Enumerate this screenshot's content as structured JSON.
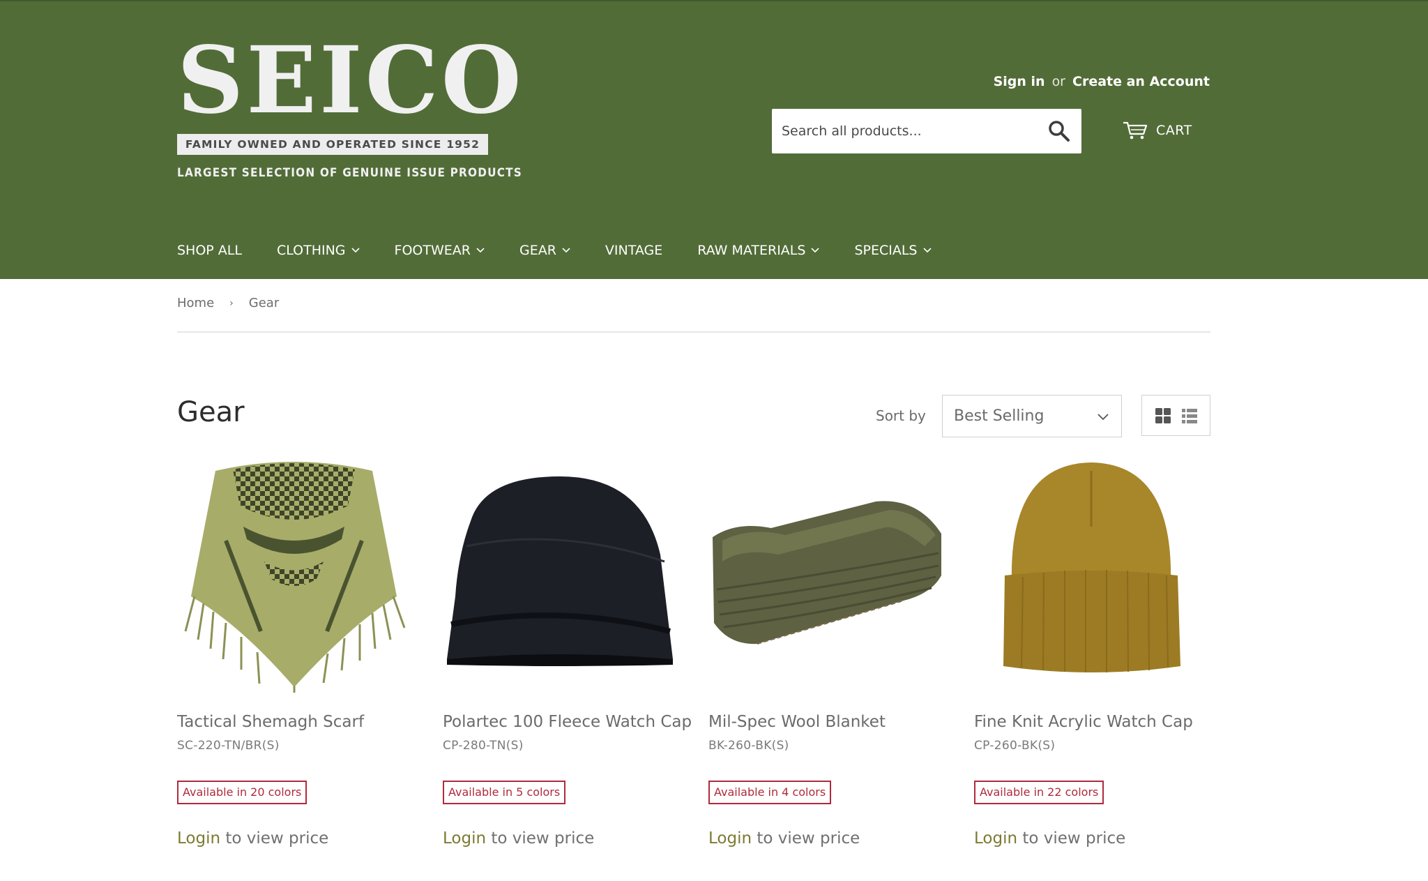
{
  "brand": {
    "logo_word": "SEICO",
    "logo_band": "FAMILY OWNED AND OPERATED SINCE 1952",
    "logo_tagline": "LARGEST SELECTION OF GENUINE ISSUE PRODUCTS",
    "header_color": "#526c38"
  },
  "account": {
    "sign_in": "Sign in",
    "or": "or",
    "create": "Create an Account"
  },
  "search": {
    "placeholder": "Search all products..."
  },
  "cart": {
    "label": "CART"
  },
  "nav": {
    "items": [
      {
        "label": "SHOP ALL",
        "dropdown": false
      },
      {
        "label": "CLOTHING",
        "dropdown": true
      },
      {
        "label": "FOOTWEAR",
        "dropdown": true
      },
      {
        "label": "GEAR",
        "dropdown": true
      },
      {
        "label": "VINTAGE",
        "dropdown": false
      },
      {
        "label": "RAW MATERIALS",
        "dropdown": true
      },
      {
        "label": "SPECIALS",
        "dropdown": true
      }
    ]
  },
  "breadcrumb": {
    "home": "Home",
    "separator": "›",
    "current": "Gear"
  },
  "collection": {
    "title": "Gear",
    "sort_label": "Sort by",
    "sort_value": "Best Selling"
  },
  "products": [
    {
      "title": "Tactical Shemagh Scarf",
      "sku": "SC-220-TN/BR(S)",
      "badge": "Available in 20 colors",
      "login": "Login",
      "price_text": " to view price",
      "image": "shemagh-scarf"
    },
    {
      "title": "Polartec 100 Fleece Watch Cap",
      "sku": "CP-280-TN(S)",
      "badge": "Available in 5 colors",
      "login": "Login",
      "price_text": " to view price",
      "image": "fleece-watch-cap"
    },
    {
      "title": "Mil-Spec Wool Blanket",
      "sku": "BK-260-BK(S)",
      "badge": "Available in 4 colors",
      "login": "Login",
      "price_text": " to view price",
      "image": "wool-blanket"
    },
    {
      "title": "Fine Knit Acrylic Watch Cap",
      "sku": "CP-260-BK(S)",
      "badge": "Available in 22 colors",
      "login": "Login",
      "price_text": " to view price",
      "image": "acrylic-watch-cap"
    }
  ],
  "colors": {
    "badge": "#b02a3a",
    "login_link": "#7d7a31"
  }
}
